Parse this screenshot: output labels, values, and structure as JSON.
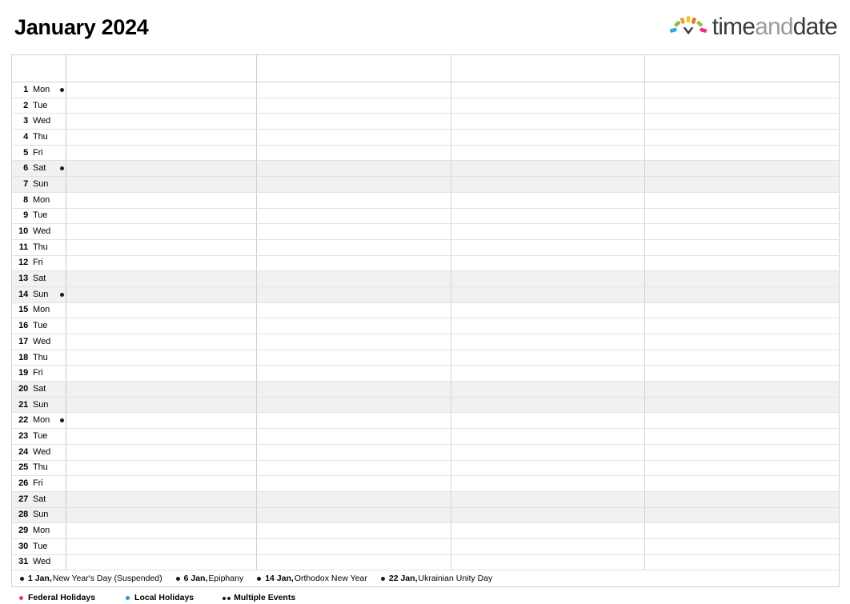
{
  "header": {
    "title": "January 2024",
    "brand": {
      "name_dark_1": "time",
      "name_gray": "and",
      "name_dark_2": "date",
      "mark_icon": "timeanddate-sun-clock-icon"
    }
  },
  "colors": {
    "federal_holiday": "#e8308a",
    "local_holiday": "#2196e0",
    "multiple_events": "#1a1a1a",
    "event_dot": "#1a1a1a",
    "weekend_background": "#f1f1f1",
    "grid_border": "#d2d2d2",
    "row_border": "#e2e2e2",
    "brand_dark": "#3a3a3a",
    "brand_gray": "#9b9b9b"
  },
  "calendar": {
    "columns": [
      "",
      "",
      "",
      "",
      ""
    ],
    "days": [
      {
        "num": "1",
        "weekday": "Mon",
        "weekend": false,
        "dots": 1
      },
      {
        "num": "2",
        "weekday": "Tue",
        "weekend": false,
        "dots": 0
      },
      {
        "num": "3",
        "weekday": "Wed",
        "weekend": false,
        "dots": 0
      },
      {
        "num": "4",
        "weekday": "Thu",
        "weekend": false,
        "dots": 0
      },
      {
        "num": "5",
        "weekday": "Fri",
        "weekend": false,
        "dots": 0
      },
      {
        "num": "6",
        "weekday": "Sat",
        "weekend": true,
        "dots": 1
      },
      {
        "num": "7",
        "weekday": "Sun",
        "weekend": true,
        "dots": 0
      },
      {
        "num": "8",
        "weekday": "Mon",
        "weekend": false,
        "dots": 0
      },
      {
        "num": "9",
        "weekday": "Tue",
        "weekend": false,
        "dots": 0
      },
      {
        "num": "10",
        "weekday": "Wed",
        "weekend": false,
        "dots": 0
      },
      {
        "num": "11",
        "weekday": "Thu",
        "weekend": false,
        "dots": 0
      },
      {
        "num": "12",
        "weekday": "Fri",
        "weekend": false,
        "dots": 0
      },
      {
        "num": "13",
        "weekday": "Sat",
        "weekend": true,
        "dots": 0
      },
      {
        "num": "14",
        "weekday": "Sun",
        "weekend": true,
        "dots": 1
      },
      {
        "num": "15",
        "weekday": "Mon",
        "weekend": false,
        "dots": 0
      },
      {
        "num": "16",
        "weekday": "Tue",
        "weekend": false,
        "dots": 0
      },
      {
        "num": "17",
        "weekday": "Wed",
        "weekend": false,
        "dots": 0
      },
      {
        "num": "18",
        "weekday": "Thu",
        "weekend": false,
        "dots": 0
      },
      {
        "num": "19",
        "weekday": "Fri",
        "weekend": false,
        "dots": 0
      },
      {
        "num": "20",
        "weekday": "Sat",
        "weekend": true,
        "dots": 0
      },
      {
        "num": "21",
        "weekday": "Sun",
        "weekend": true,
        "dots": 0
      },
      {
        "num": "22",
        "weekday": "Mon",
        "weekend": false,
        "dots": 1
      },
      {
        "num": "23",
        "weekday": "Tue",
        "weekend": false,
        "dots": 0
      },
      {
        "num": "24",
        "weekday": "Wed",
        "weekend": false,
        "dots": 0
      },
      {
        "num": "25",
        "weekday": "Thu",
        "weekend": false,
        "dots": 0
      },
      {
        "num": "26",
        "weekday": "Fri",
        "weekend": false,
        "dots": 0
      },
      {
        "num": "27",
        "weekday": "Sat",
        "weekend": true,
        "dots": 0
      },
      {
        "num": "28",
        "weekday": "Sun",
        "weekend": true,
        "dots": 0
      },
      {
        "num": "29",
        "weekday": "Mon",
        "weekend": false,
        "dots": 0
      },
      {
        "num": "30",
        "weekday": "Tue",
        "weekend": false,
        "dots": 0
      },
      {
        "num": "31",
        "weekday": "Wed",
        "weekend": false,
        "dots": 0
      }
    ]
  },
  "events": [
    {
      "date": "1 Jan,",
      "name": "New Year's Day (Suspended)"
    },
    {
      "date": "6 Jan,",
      "name": "Epiphany"
    },
    {
      "date": "14 Jan,",
      "name": "Orthodox New Year"
    },
    {
      "date": "22 Jan,",
      "name": "Ukrainian Unity Day"
    }
  ],
  "legend": [
    {
      "label": "Federal Holidays",
      "color": "#e8308a",
      "style": "single"
    },
    {
      "label": "Local Holidays",
      "color": "#2196e0",
      "style": "single"
    },
    {
      "label": "Multiple Events",
      "color": "#1a1a1a",
      "style": "double"
    }
  ]
}
